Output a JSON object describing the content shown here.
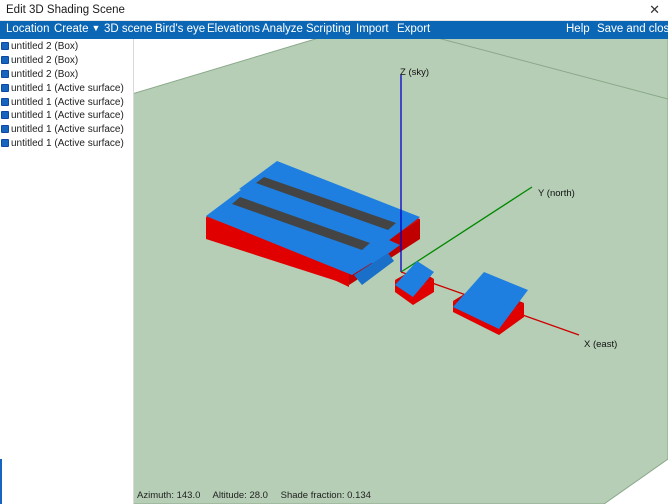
{
  "window": {
    "title": "Edit 3D Shading Scene",
    "close_glyph": "✕"
  },
  "menu": {
    "location": "Location",
    "create": "Create",
    "scene3d": "3D scene",
    "birds_eye": "Bird's eye",
    "elevations": "Elevations",
    "analyze": "Analyze",
    "scripting": "Scripting",
    "import": "Import",
    "export": "Export",
    "help": "Help",
    "save_close": "Save and close"
  },
  "objects": [
    "untitled 2 (Box)",
    "untitled 2 (Box)",
    "untitled 2 (Box)",
    "untitled 1 (Active surface)",
    "untitled 1 (Active surface)",
    "untitled 1 (Active surface)",
    "untitled 1 (Active surface)",
    "untitled 1 (Active surface)"
  ],
  "axes": {
    "z": "Z (sky)",
    "y": "Y (north)",
    "x": "X (east)"
  },
  "status": {
    "azimuth": "Azimuth: 143.0",
    "altitude": "Altitude: 28.0",
    "shade_fraction": "Shade fraction: 0.134"
  },
  "colors": {
    "menubar": "#0b67b5",
    "ground": "#b6ceb5",
    "box": "#e00000",
    "surface": "#1e7fe0",
    "panel_strip": "#444444",
    "z_axis": "#0000cc",
    "y_axis": "#008800",
    "x_axis": "#cc0000"
  }
}
